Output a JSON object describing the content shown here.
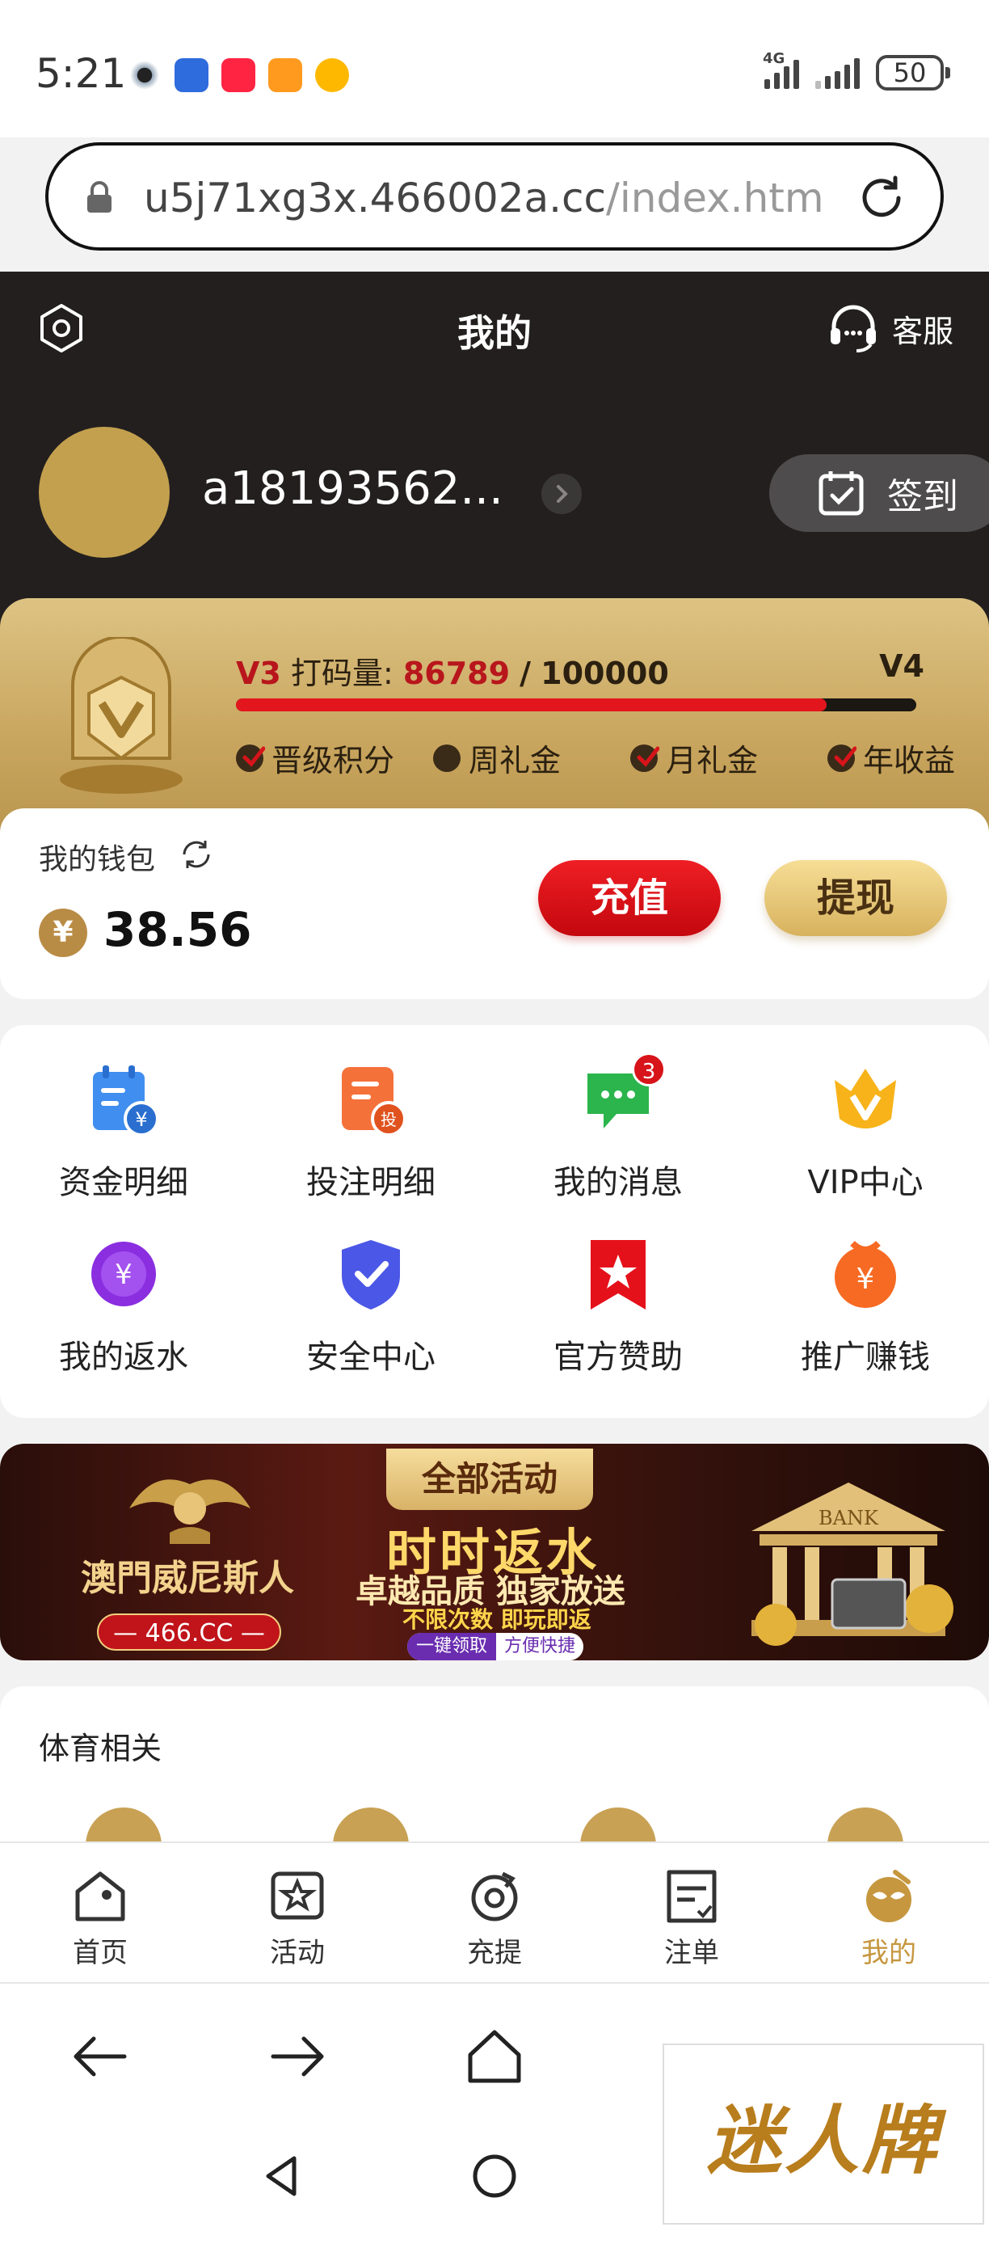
{
  "status_bar": {
    "time": "5:21",
    "network": "4G",
    "battery": "50",
    "app_icons": [
      "camera-app-icon",
      "blue-app-icon",
      "xiaohongshu-app-icon",
      "video-app-icon",
      "weibo-app-icon"
    ]
  },
  "browser": {
    "url_main": "u5j71xg3x.466002a.cc",
    "url_rest": "/index.html?"
  },
  "header": {
    "title": "我的",
    "customer_service": "客服",
    "username": "a18193562...",
    "checkin": "签到"
  },
  "vip": {
    "current_level": "V3",
    "progress_label": "打码量",
    "progress_current": "86789",
    "progress_separator": "/",
    "progress_target": "100000",
    "progress_fraction": 0.868,
    "next_level": "V4",
    "perks": [
      {
        "label": "晋级积分",
        "checked": true
      },
      {
        "label": "周礼金",
        "checked": false
      },
      {
        "label": "月礼金",
        "checked": true
      },
      {
        "label": "年收益",
        "checked": true
      }
    ]
  },
  "wallet": {
    "title": "我的钱包",
    "currency_symbol": "¥",
    "balance": "38.56",
    "deposit_label": "充值",
    "withdraw_label": "提现"
  },
  "quick_menu": [
    {
      "label": "资金明细",
      "icon": "fund-detail-icon"
    },
    {
      "label": "投注明细",
      "icon": "bet-detail-icon"
    },
    {
      "label": "我的消息",
      "icon": "message-icon",
      "badge": "3"
    },
    {
      "label": "VIP中心",
      "icon": "vip-crown-icon"
    },
    {
      "label": "我的返水",
      "icon": "rebate-icon"
    },
    {
      "label": "安全中心",
      "icon": "security-shield-icon"
    },
    {
      "label": "官方赞助",
      "icon": "sponsor-star-icon"
    },
    {
      "label": "推广赚钱",
      "icon": "promote-coin-icon"
    }
  ],
  "banner": {
    "brand": "澳門威尼斯人",
    "domain": "— 466.CC —",
    "tag": "全部活动",
    "headline": "时时返水",
    "subline": "卓越品质 独家放送",
    "small": "不限次数 即玩即返",
    "cta_left": "一键领取",
    "cta_right": "方便快捷",
    "bank_word": "BANK"
  },
  "sports": {
    "title": "体育相关"
  },
  "bottom_nav": [
    {
      "label": "首页",
      "icon": "home-icon",
      "active": false
    },
    {
      "label": "活动",
      "icon": "activity-star-icon",
      "active": false
    },
    {
      "label": "充提",
      "icon": "deposit-withdraw-icon",
      "active": false
    },
    {
      "label": "注单",
      "icon": "bet-slip-icon",
      "active": false
    },
    {
      "label": "我的",
      "icon": "profile-mask-icon",
      "active": true
    }
  ],
  "watermark": {
    "text": "迷人牌"
  },
  "colors": {
    "header_bg": "#231f1f",
    "gold": "#c6973f",
    "red": "#d7141a"
  }
}
